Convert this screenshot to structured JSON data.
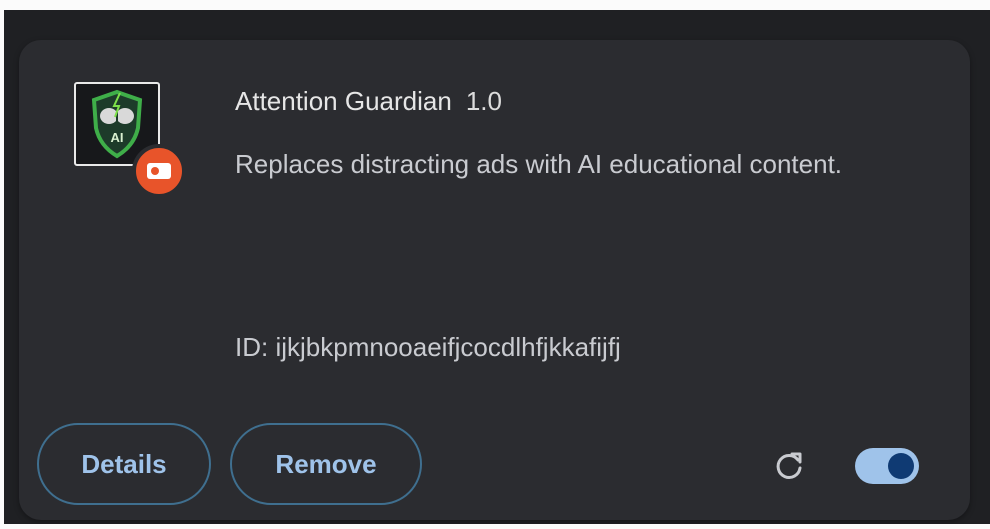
{
  "extension": {
    "name": "Attention Guardian",
    "version": "1.0",
    "description": "Replaces distracting ads with AI educational content.",
    "id_text": "ID: ijkjbkpmnooaeifjcocdlhfjkkafijfj",
    "icon": "shield-brain-ai-icon",
    "icon_label": "AI",
    "badge_icon": "unpacked-extension-badge-icon"
  },
  "actions": {
    "details_label": "Details",
    "remove_label": "Remove",
    "reload_icon": "reload-icon",
    "toggle_enabled": true
  },
  "colors": {
    "background": "#1f2023",
    "card": "#2b2c30",
    "accent": "#9fc3ea",
    "badge": "#e8542a",
    "toggle_knob": "#0f3a73"
  }
}
